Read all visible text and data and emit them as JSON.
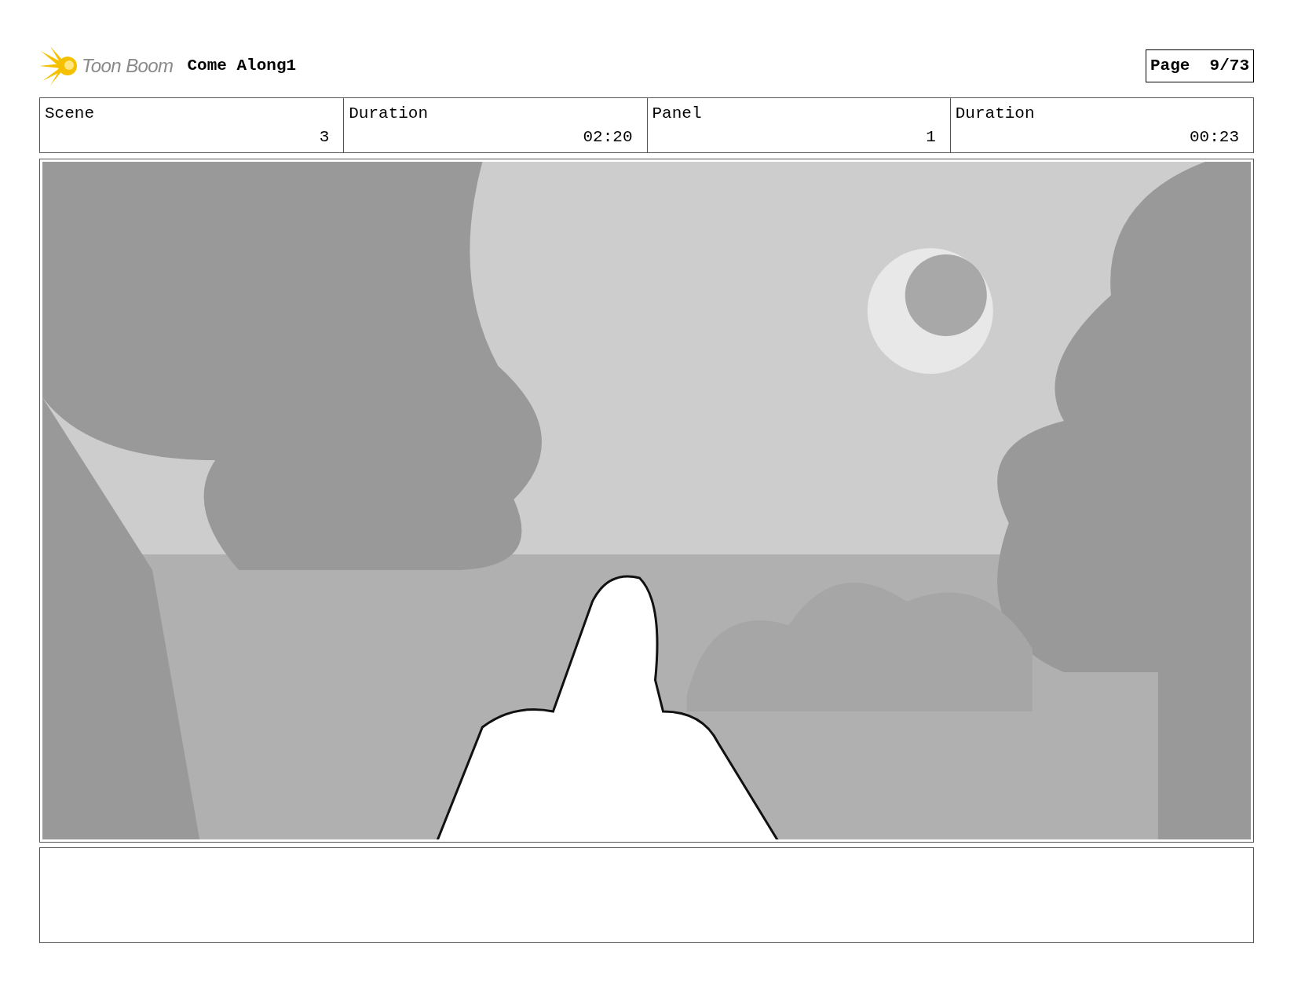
{
  "header": {
    "logo_text": "Toon Boom",
    "project": "Come Along1",
    "page": "Page  9/73"
  },
  "info": [
    {
      "label": "Scene",
      "value": "3"
    },
    {
      "label": "Duration",
      "value": "02:20"
    },
    {
      "label": "Panel",
      "value": "1"
    },
    {
      "label": "Duration",
      "value": "00:23"
    }
  ]
}
